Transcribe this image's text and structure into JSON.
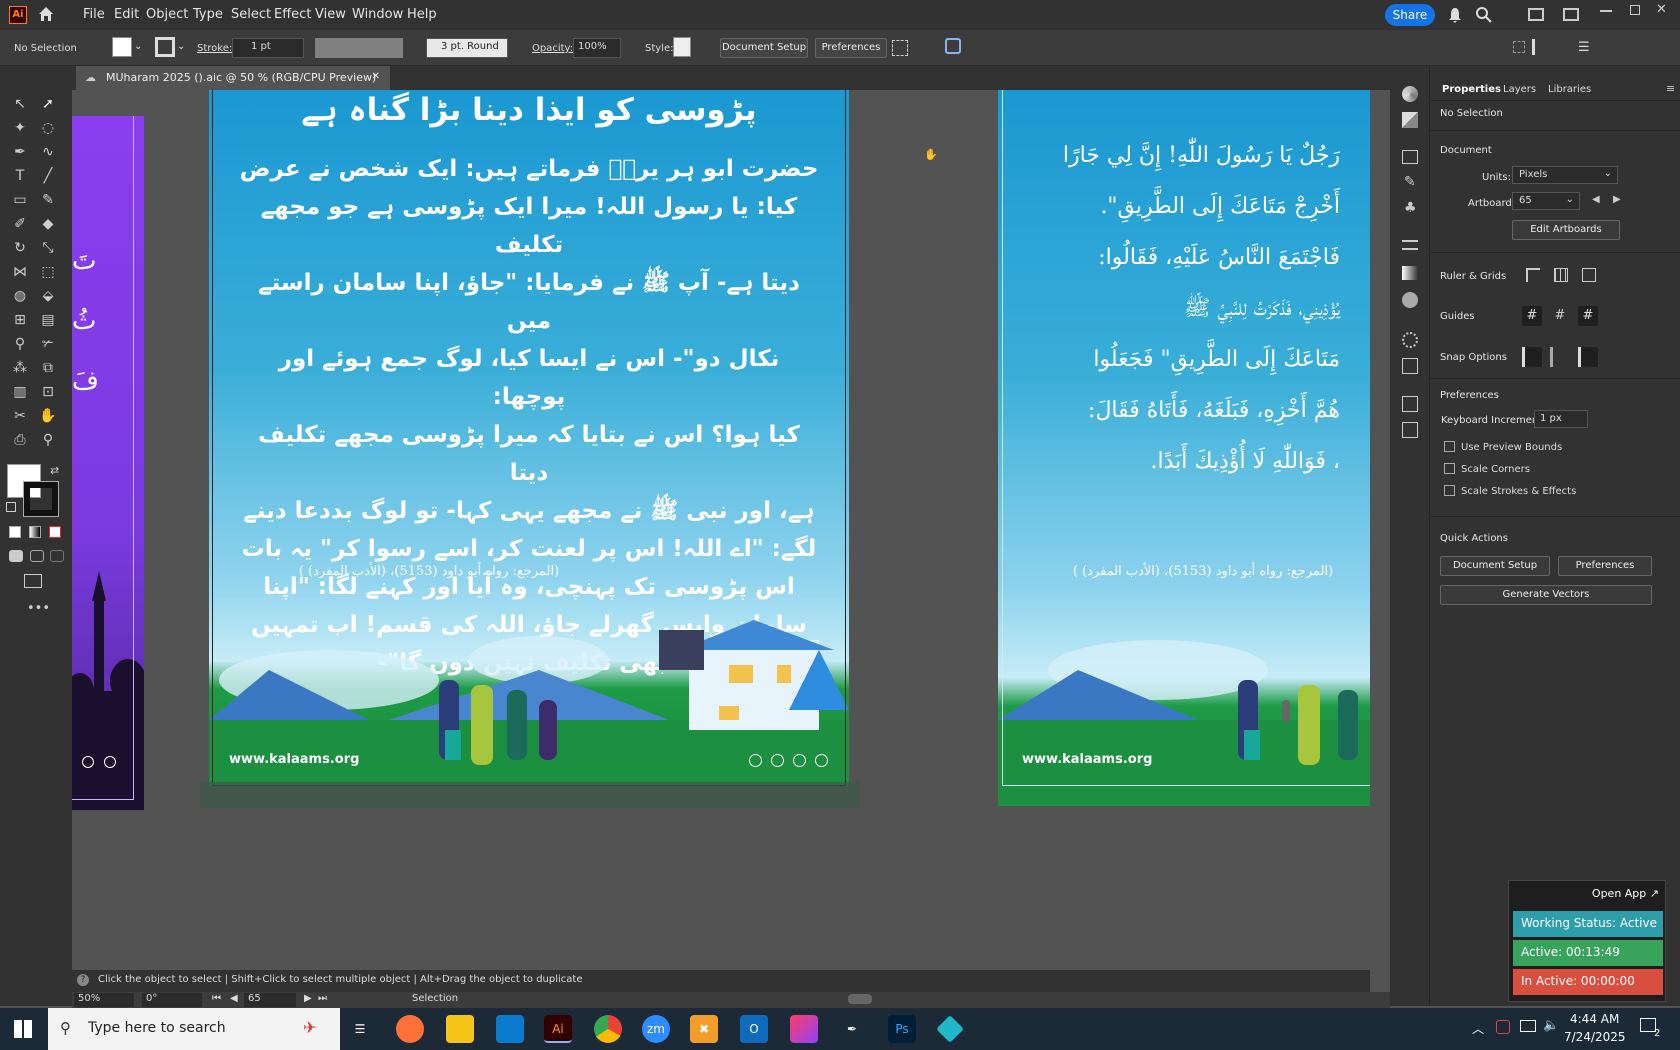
{
  "app": {
    "logo": "Ai",
    "menu": [
      "File",
      "Edit",
      "Object",
      "Type",
      "Select",
      "Effect",
      "View",
      "Window",
      "Help"
    ],
    "share_label": "Share"
  },
  "control_bar": {
    "selection": "No Selection",
    "stroke_label": "Stroke:",
    "stroke_value": "1 pt",
    "brush_value": "3 pt. Round",
    "opacity_label": "Opacity:",
    "opacity_value": "100%",
    "style_label": "Style:",
    "document_setup": "Document Setup",
    "preferences": "Preferences"
  },
  "document_tab": {
    "title": "MUharam 2025 ().aic @ 50 % (RGB/CPU Preview)",
    "close": "✕"
  },
  "artboard_main": {
    "title": "پڑوسی کو ایذا دینا بڑا گناہ ہے",
    "body_lines": [
      "حضرت ابو ہر یرہؓ فرماتے ہیں: ایک شخص نے عرض",
      "کیا: یا رسول اللہ! میرا ایک پڑوسی ہے جو مجھے تکلیف",
      "دیتا ہے- آپ ﷺ نے فرمایا: \"جاؤ، اپنا سامان راستے میں",
      "نکال دو\"- اس نے ایسا کیا، لوگ جمع ہوئے اور پوچھا:",
      "کیا ہوا؟ اس نے بتایا کہ میرا پڑوسی مجھے تکلیف دیتا",
      "ہے، اور نبی ﷺ نے مجھے یہی کہا- تو لوگ بددعا دینے",
      "لگے: \"اے اللہ! اس پر لعنت کر، اسے رسوا کر\" یہ بات",
      "اس پڑوسی تک پہنچی، وہ آیا اور کہنے لگا: \"اپنا",
      "سامان واپس گھرلے جاؤ، اللہ کی قسم! اب تمہیں",
      "کبھی تکلیف نہیں دوں گا\"-"
    ],
    "reference": "(المرجع: رواه أبو داود (5153)، (الأدب المفرد) )",
    "website": "www.kalaams.org"
  },
  "artboard_right": {
    "lines": [
      "رَجُلٌ يَا رَسُولَ اللّٰهِ! إِنَّ لِي جَارًا",
      "أَخْرِجْ مَتَاعَكَ إِلَى الطَّرِيقِ\".",
      "فَاجْتَمَعَ النَّاسُ عَلَيْهِ، فَقَالُوا:",
      "يُؤْذِينِي، فَذَكَرْتُ لِلنَّبِيِّ ﷺ",
      "مَتَاعَكَ إِلَى الطَّرِيقِ\" فَجَعَلُوا",
      "هُمَّ أَخْزِهِ، فَبَلَغَهُ، فَأَتَاهُ فَقَالَ:",
      "، فَوَاللّٰهِ لَا أُؤْذِيكَ أَبَدًا."
    ],
    "reference": "(المرجع: رواه أبو داود (5153)، (الأدب المفرد) )",
    "website": "www.kalaams.org"
  },
  "artboard_left": {
    "lines": [
      "تَ",
      "ثُ",
      "فَ"
    ]
  },
  "properties_panel": {
    "tabs": [
      "Properties",
      "Layers",
      "Libraries"
    ],
    "selection": "No Selection",
    "document_header": "Document",
    "units_label": "Units:",
    "units_value": "Pixels",
    "artboard_label": "Artboard:",
    "artboard_value": "65",
    "edit_artboards": "Edit Artboards",
    "ruler_grids": "Ruler & Grids",
    "guides": "Guides",
    "snap_options": "Snap Options",
    "preferences_header": "Preferences",
    "keyboard_increment_label": "Keyboard Increment:",
    "keyboard_increment_value": "1 px",
    "checkboxes": [
      "Use Preview Bounds",
      "Scale Corners",
      "Scale Strokes & Effects"
    ],
    "quick_actions": "Quick Actions",
    "document_setup": "Document Setup",
    "preferences": "Preferences",
    "generate_vectors": "Generate Vectors"
  },
  "status_bar": {
    "hint": "Click the object to select  |  Shift+Click to select multiple object  |  Alt+Drag the object to duplicate",
    "zoom": "50%",
    "rotation": "0°",
    "artboard_num": "65",
    "mode": "Selection"
  },
  "status_widget": {
    "open_app": "Open App ↗",
    "working_status": "Working Status: Active",
    "active_time": "Active: 00:13:49",
    "inactive_time": "In Active: 00:00:00",
    "colors": {
      "working": "#2e9eaa",
      "active": "#3aa35b",
      "inactive": "#d94f3f"
    }
  },
  "taskbar": {
    "search_placeholder": "Type here to search",
    "time": "4:44 AM",
    "date": "7/24/2025",
    "notifications": "2",
    "apps": [
      "task-view",
      "firefox",
      "file-explorer",
      "vscode",
      "illustrator",
      "chrome",
      "zoom",
      "app-x",
      "outlook",
      "creative-cloud",
      "pen-tool",
      "photoshop",
      "app-diamond"
    ]
  },
  "colors": {
    "accent": "#1473e6",
    "artboard_sky_top": "#1d9ed4",
    "artboard_sky_bottom": "#bfe8f5",
    "ground": "#1a8a3c"
  }
}
